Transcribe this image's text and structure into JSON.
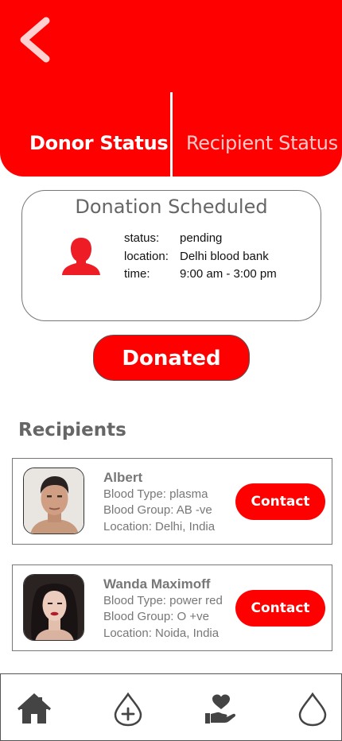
{
  "header": {
    "tabs": [
      {
        "label": "Donor Status",
        "active": true
      },
      {
        "label": "Recipient Status",
        "active": false
      }
    ]
  },
  "schedule": {
    "title": "Donation Scheduled",
    "details": [
      {
        "key": "status:",
        "value": "pending"
      },
      {
        "key": "location:",
        "value": "Delhi blood bank"
      },
      {
        "key": "time:",
        "value": "9:00 am - 3:00 pm"
      }
    ]
  },
  "donated_button": "Donated",
  "recipients": {
    "title": "Recipients",
    "items": [
      {
        "name": "Albert",
        "blood_type": "Blood Type: plasma",
        "blood_group": "Blood Group: AB -ve",
        "location": "Location: Delhi, India",
        "contact_label": "Contact"
      },
      {
        "name": "Wanda Maximoff",
        "blood_type": "Blood Type: power red",
        "blood_group": "Blood Group: O +ve",
        "location": "Location: Noida, India",
        "contact_label": "Contact"
      }
    ]
  },
  "nav": {
    "items": [
      {
        "icon": "home-icon"
      },
      {
        "icon": "donate-blood-icon"
      },
      {
        "icon": "hand-heart-icon"
      },
      {
        "icon": "blood-drop-icon"
      }
    ]
  },
  "colors": {
    "accent": "#ff0000",
    "inactive_tab": "#ffc9c9",
    "muted_text": "#777777"
  }
}
